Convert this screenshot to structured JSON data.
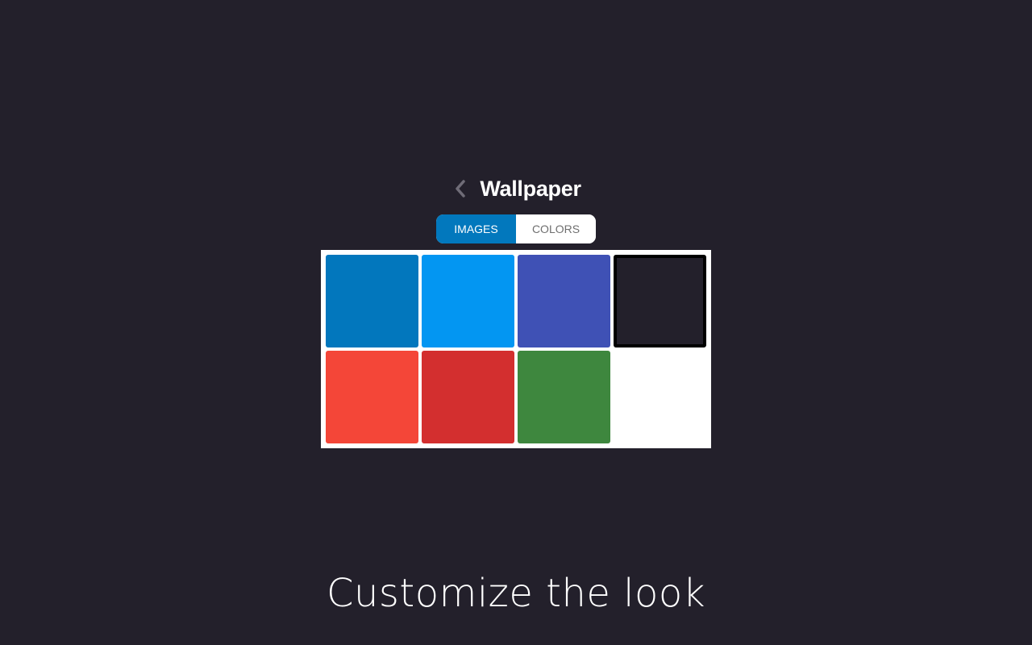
{
  "header": {
    "back_icon": "chevron-left-icon",
    "title": "Wallpaper"
  },
  "tabs": [
    {
      "label": "IMAGES",
      "active": true
    },
    {
      "label": "COLORS",
      "active": false
    }
  ],
  "swatches": [
    {
      "name": "dark-blue",
      "color": "#0277bd",
      "selected": false
    },
    {
      "name": "light-blue",
      "color": "#0396f2",
      "selected": false
    },
    {
      "name": "indigo",
      "color": "#3f51b5",
      "selected": false
    },
    {
      "name": "dark",
      "color": "#23202b",
      "selected": true
    },
    {
      "name": "orange-red",
      "color": "#f44638",
      "selected": false
    },
    {
      "name": "red",
      "color": "#d32f2f",
      "selected": false
    },
    {
      "name": "green",
      "color": "#3e873e",
      "selected": false
    }
  ],
  "caption": "Customize the look",
  "colors": {
    "background": "#23202b",
    "accent": "#0278bd"
  }
}
